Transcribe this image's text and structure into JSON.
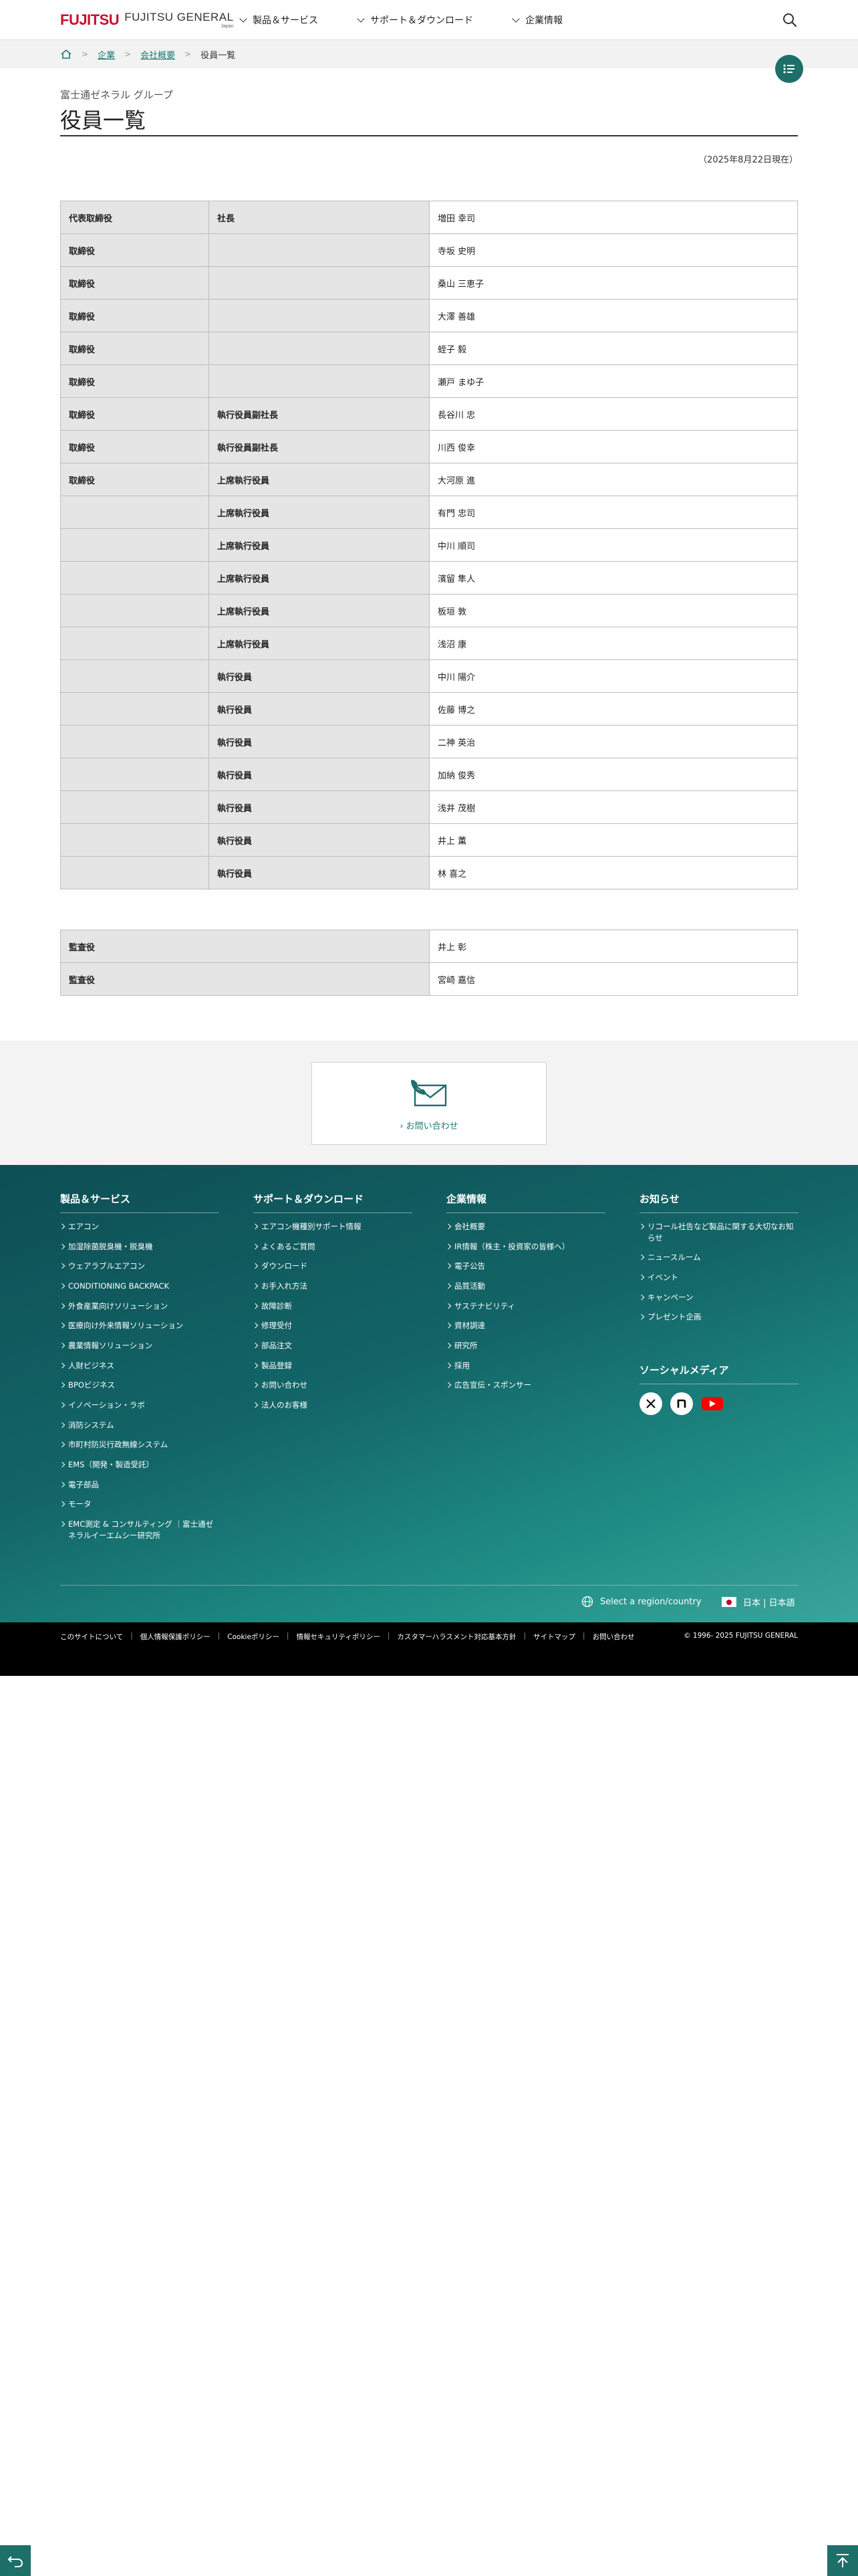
{
  "header": {
    "logo_mark": "FUJITSU",
    "logo_main": "FUJITSU GENERAL",
    "logo_sub": "Japan",
    "nav": [
      "製品＆サービス",
      "サポート＆ダウンロード",
      "企業情報"
    ]
  },
  "breadcrumb": {
    "items": [
      "企業",
      "会社概要"
    ],
    "current": "役員一覧"
  },
  "page": {
    "group_label": "富士通ゼネラル グループ",
    "title": "役員一覧",
    "date_note": "（2025年8月22日現在）"
  },
  "officers": [
    {
      "role": "代表取締役",
      "position": "社長",
      "name": "増田 幸司"
    },
    {
      "role": "取締役",
      "position": "",
      "name": "寺坂 史明"
    },
    {
      "role": "取締役",
      "position": "",
      "name": "桑山 三恵子"
    },
    {
      "role": "取締役",
      "position": "",
      "name": "大澤 善雄"
    },
    {
      "role": "取締役",
      "position": "",
      "name": "蛭子 毅"
    },
    {
      "role": "取締役",
      "position": "",
      "name": "瀬戸 まゆ子"
    },
    {
      "role": "取締役",
      "position": "執行役員副社長",
      "name": "長谷川 忠"
    },
    {
      "role": "取締役",
      "position": "執行役員副社長",
      "name": "川西 俊幸"
    },
    {
      "role": "取締役",
      "position": "上席執行役員",
      "name": "大河原 進"
    },
    {
      "role": "",
      "position": "上席執行役員",
      "name": "有門 忠司"
    },
    {
      "role": "",
      "position": "上席執行役員",
      "name": "中川 順司"
    },
    {
      "role": "",
      "position": "上席執行役員",
      "name": "濱留 隼人"
    },
    {
      "role": "",
      "position": "上席執行役員",
      "name": "板垣 敦"
    },
    {
      "role": "",
      "position": "上席執行役員",
      "name": "浅沼 康"
    },
    {
      "role": "",
      "position": "執行役員",
      "name": "中川 陽介"
    },
    {
      "role": "",
      "position": "執行役員",
      "name": "佐藤 博之"
    },
    {
      "role": "",
      "position": "執行役員",
      "name": "二神 英治"
    },
    {
      "role": "",
      "position": "執行役員",
      "name": "加納 俊秀"
    },
    {
      "role": "",
      "position": "執行役員",
      "name": "浅井 茂樹"
    },
    {
      "role": "",
      "position": "執行役員",
      "name": "井上 薫"
    },
    {
      "role": "",
      "position": "執行役員",
      "name": "林 喜之"
    }
  ],
  "auditors": [
    {
      "role": "監査役",
      "name": "井上 彰"
    },
    {
      "role": "監査役",
      "name": "宮崎 嘉信"
    }
  ],
  "contact": {
    "label": "お問い合わせ"
  },
  "footer": {
    "columns": [
      {
        "title": "製品＆サービス",
        "items": [
          "エアコン",
          "加湿除菌脱臭機・脱臭機",
          "ウェアラブルエアコン",
          "CONDITIONING BACKPACK",
          "外食産業向けソリューション",
          "医療向け外来情報ソリューション",
          "農業情報ソリューション",
          "人財ビジネス",
          "BPOビジネス",
          "イノベーション・ラボ",
          "消防システム",
          "市町村防災行政無線システム",
          "EMS（開発・製造受託）",
          "電子部品",
          "モータ",
          "EMC測定 & コンサルティング ｜富士通ゼネラルイーエムシー研究所"
        ]
      },
      {
        "title": "サポート＆ダウンロード",
        "items": [
          "エアコン機種別サポート情報",
          "よくあるご質問",
          "ダウンロード",
          "お手入れ方法",
          "故障診断",
          "修理受付",
          "部品注文",
          "製品登録",
          "お問い合わせ",
          "法人のお客様"
        ]
      },
      {
        "title": "企業情報",
        "items": [
          "会社概要",
          "IR情報（株主・投資家の皆様へ）",
          "電子公告",
          "品質活動",
          "サステナビリティ",
          "資材調達",
          "研究所",
          "採用",
          "広告宣伝・スポンサー"
        ]
      },
      {
        "title": "お知らせ",
        "items": [
          "リコール社告など製品に関する大切なお知らせ",
          "ニュースルーム",
          "イベント",
          "キャンペーン",
          "プレゼント企画"
        ]
      }
    ],
    "social_title": "ソーシャルメディア",
    "region_label": "Select a region/country",
    "lang_label": "日本 | 日本語",
    "bottom_links": [
      "このサイトについて",
      "個人情報保護ポリシー",
      "Cookieポリシー",
      "情報セキュリティポリシー",
      "カスタマーハラスメント対応基本方針",
      "サイトマップ",
      "お問い合わせ"
    ],
    "copyright": "© 1996- 2025 FUJITSU GENERAL"
  },
  "colors": {
    "accent": "#1d6f69",
    "link": "#1a7a73",
    "logo_red": "#c8102e",
    "footer_bg": "#136567"
  }
}
